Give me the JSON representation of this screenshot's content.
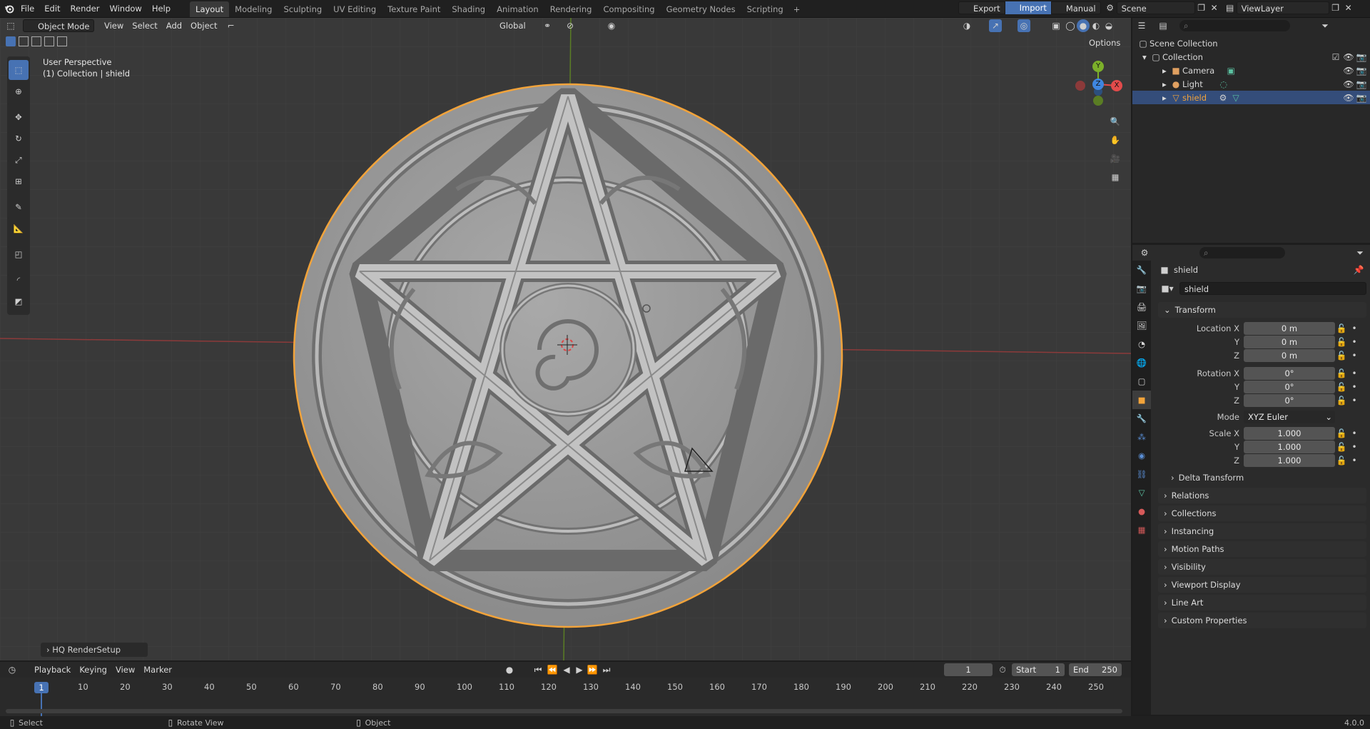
{
  "topbar": {
    "menus": [
      "File",
      "Edit",
      "Render",
      "Window",
      "Help"
    ],
    "workspaces": [
      "Layout",
      "Modeling",
      "Sculpting",
      "UV Editing",
      "Texture Paint",
      "Shading",
      "Animation",
      "Rendering",
      "Compositing",
      "Geometry Nodes",
      "Scripting"
    ],
    "active_workspace": "Layout",
    "add_tab": "+",
    "export": "Export",
    "import": "Import",
    "manual": "Manual",
    "scene": "Scene",
    "viewlayer": "ViewLayer"
  },
  "viewport": {
    "mode": "Object Mode",
    "menus": [
      "View",
      "Select",
      "Add",
      "Object"
    ],
    "transform_orientation": "Global",
    "options": "Options",
    "info_line1": "User Perspective",
    "info_line2": "(1) Collection | shield",
    "last_op": "HQ RenderSetup",
    "gizmo": {
      "x": "X",
      "y": "Y",
      "z": "Z"
    }
  },
  "outliner": {
    "root": "Scene Collection",
    "collection": "Collection",
    "items": [
      {
        "label": "Camera",
        "icon": "camera-icon",
        "selected": false
      },
      {
        "label": "Light",
        "icon": "light-icon",
        "selected": false
      },
      {
        "label": "shield",
        "icon": "mesh-icon",
        "selected": true
      }
    ]
  },
  "properties": {
    "object_name": "shield",
    "datablock_name": "shield",
    "transform_title": "Transform",
    "location": {
      "label": "Location X",
      "x": "0 m",
      "y": "0 m",
      "z": "0 m"
    },
    "rotation": {
      "label": "Rotation X",
      "x": "0°",
      "y": "0°",
      "z": "0°"
    },
    "mode_label": "Mode",
    "mode_value": "XYZ Euler",
    "scale": {
      "label": "Scale X",
      "x": "1.000",
      "y": "1.000",
      "z": "1.000"
    },
    "axis_y": "Y",
    "axis_z": "Z",
    "delta": "Delta Transform",
    "panels": [
      "Relations",
      "Collections",
      "Instancing",
      "Motion Paths",
      "Visibility",
      "Viewport Display",
      "Line Art",
      "Custom Properties"
    ]
  },
  "timeline": {
    "menus": [
      "Playback",
      "Keying",
      "View",
      "Marker"
    ],
    "current_frame": "1",
    "start_label": "Start",
    "start": "1",
    "end_label": "End",
    "end": "250",
    "ticks": [
      "10",
      "20",
      "30",
      "40",
      "50",
      "60",
      "70",
      "80",
      "90",
      "100",
      "110",
      "120",
      "130",
      "140",
      "150",
      "160",
      "170",
      "180",
      "190",
      "200",
      "210",
      "220",
      "230",
      "240",
      "250"
    ]
  },
  "statusbar": {
    "select": "Select",
    "rotate": "Rotate View",
    "object": "Object",
    "version": "4.0.0"
  },
  "colors": {
    "accent": "#4772b3",
    "selection_outline": "#f2a33a",
    "x_axis": "#e24b4b",
    "y_axis": "#7cb02a",
    "z_axis": "#3f86e0"
  }
}
